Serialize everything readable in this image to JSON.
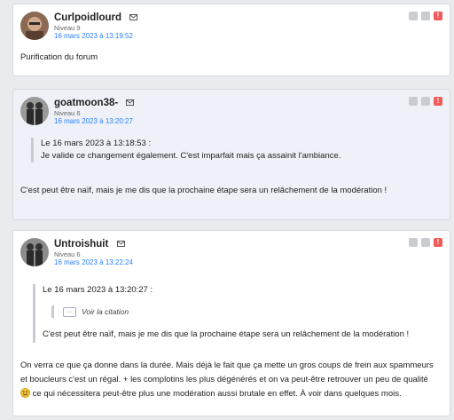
{
  "posts": [
    {
      "author": "Curlpoidlourd",
      "level": "Niveau 9",
      "date": "16 mars 2023 à 13:19:52",
      "text": "Purification du forum"
    },
    {
      "author": "goatmoon38-",
      "level": "Niveau 6",
      "date": "16 mars 2023 à 13:20:27",
      "quote_header": "Le 16 mars 2023 à 13:18:53 :",
      "quote_text": "Je valide ce changement également. C'est imparfait mais ça assainit l'ambiance.",
      "text": "C'est peut être naïf, mais je me dis que la prochaine étape sera un relâchement de la modération !"
    },
    {
      "author": "Untroishuit",
      "level": "Niveau 6",
      "date": "16 mars 2023 à 13:22:24",
      "quote_header": "Le 16 mars 2023 à 13:20:27 :",
      "inner_quote_dots": "···",
      "inner_quote_link": "Voir la citation",
      "quote_text": "C'est peut être naïf, mais je me dis que la prochaine étape sera un relâchement de la modération !",
      "text_line1": "On verra ce que ça donne dans la durée. Mais déjà le fait que ça mette un gros coups de frein aux spammeurs",
      "text_line2": "et boucleurs c'est un régal. + les complotins les plus dégénérés et on va peut-être retrouver un peu de qualité",
      "text_line3": "ce qui nécessitera peut-être plus une modération aussi brutale en effet. À voir dans quelques mois."
    }
  ],
  "icons": {
    "mail": "mail-icon",
    "actions": [
      "quote-icon",
      "edit-icon",
      "report-icon"
    ],
    "report_label": "!"
  },
  "colors": {
    "date": "#2a7fff",
    "report": "#f25a5a",
    "alt_background": "#eef2f8"
  }
}
